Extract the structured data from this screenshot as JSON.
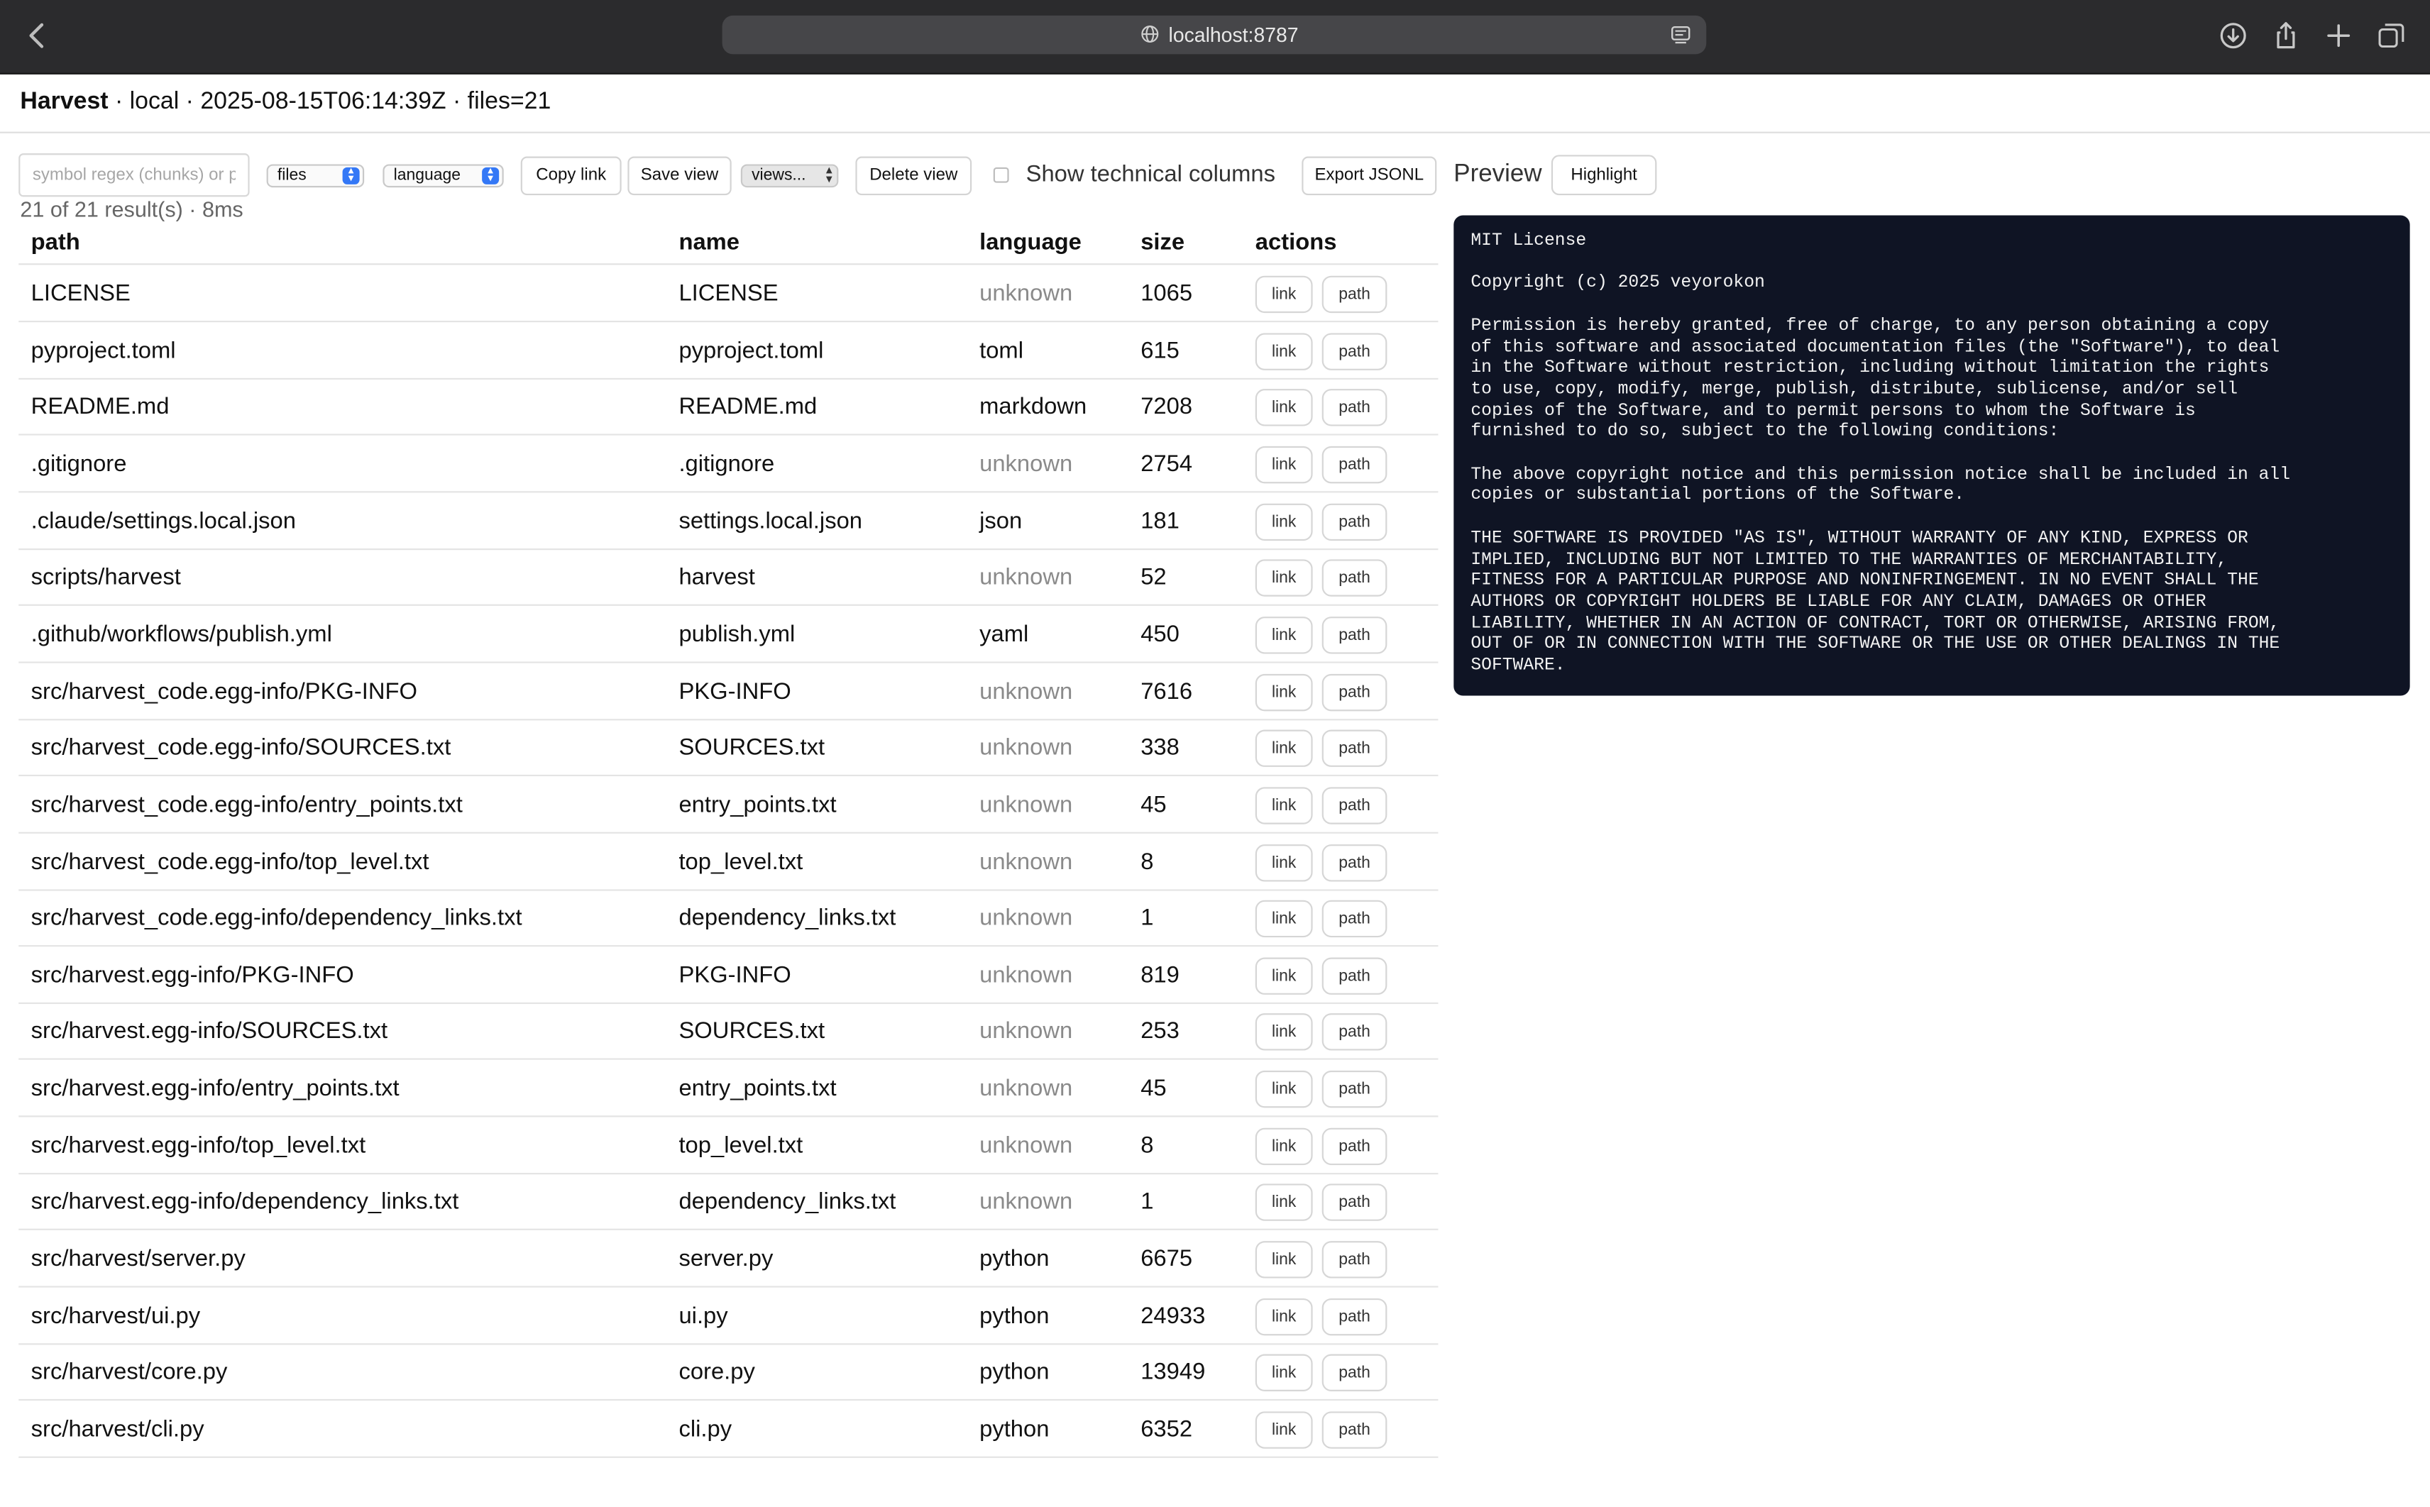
{
  "browser": {
    "url": "localhost:8787"
  },
  "header": {
    "app_name": "Harvest",
    "meta": " · local · 2025-08-15T06:14:39Z · files=21"
  },
  "toolbar": {
    "search_placeholder": "symbol regex (chunks) or p",
    "search_value": "",
    "mode_select": "files",
    "language_select": "language",
    "copy_link": "Copy link",
    "save_view": "Save view",
    "views_select": "views...",
    "delete_view": "Delete view",
    "technical_columns_label": "Show technical columns",
    "technical_columns_checked": false,
    "export_jsonl": "Export JSONL",
    "preview_label": "Preview",
    "highlight": "Highlight"
  },
  "results_summary": "21 of 21 result(s) · 8ms",
  "table": {
    "columns": [
      "path",
      "name",
      "language",
      "size",
      "actions"
    ],
    "action_labels": {
      "link": "link",
      "path": "path"
    },
    "rows": [
      {
        "path": "LICENSE",
        "name": "LICENSE",
        "language": "unknown",
        "size": "1065"
      },
      {
        "path": "pyproject.toml",
        "name": "pyproject.toml",
        "language": "toml",
        "size": "615"
      },
      {
        "path": "README.md",
        "name": "README.md",
        "language": "markdown",
        "size": "7208"
      },
      {
        "path": ".gitignore",
        "name": ".gitignore",
        "language": "unknown",
        "size": "2754"
      },
      {
        "path": ".claude/settings.local.json",
        "name": "settings.local.json",
        "language": "json",
        "size": "181"
      },
      {
        "path": "scripts/harvest",
        "name": "harvest",
        "language": "unknown",
        "size": "52"
      },
      {
        "path": ".github/workflows/publish.yml",
        "name": "publish.yml",
        "language": "yaml",
        "size": "450"
      },
      {
        "path": "src/harvest_code.egg-info/PKG-INFO",
        "name": "PKG-INFO",
        "language": "unknown",
        "size": "7616"
      },
      {
        "path": "src/harvest_code.egg-info/SOURCES.txt",
        "name": "SOURCES.txt",
        "language": "unknown",
        "size": "338"
      },
      {
        "path": "src/harvest_code.egg-info/entry_points.txt",
        "name": "entry_points.txt",
        "language": "unknown",
        "size": "45"
      },
      {
        "path": "src/harvest_code.egg-info/top_level.txt",
        "name": "top_level.txt",
        "language": "unknown",
        "size": "8"
      },
      {
        "path": "src/harvest_code.egg-info/dependency_links.txt",
        "name": "dependency_links.txt",
        "language": "unknown",
        "size": "1"
      },
      {
        "path": "src/harvest.egg-info/PKG-INFO",
        "name": "PKG-INFO",
        "language": "unknown",
        "size": "819"
      },
      {
        "path": "src/harvest.egg-info/SOURCES.txt",
        "name": "SOURCES.txt",
        "language": "unknown",
        "size": "253"
      },
      {
        "path": "src/harvest.egg-info/entry_points.txt",
        "name": "entry_points.txt",
        "language": "unknown",
        "size": "45"
      },
      {
        "path": "src/harvest.egg-info/top_level.txt",
        "name": "top_level.txt",
        "language": "unknown",
        "size": "8"
      },
      {
        "path": "src/harvest.egg-info/dependency_links.txt",
        "name": "dependency_links.txt",
        "language": "unknown",
        "size": "1"
      },
      {
        "path": "src/harvest/server.py",
        "name": "server.py",
        "language": "python",
        "size": "6675"
      },
      {
        "path": "src/harvest/ui.py",
        "name": "ui.py",
        "language": "python",
        "size": "24933"
      },
      {
        "path": "src/harvest/core.py",
        "name": "core.py",
        "language": "python",
        "size": "13949"
      },
      {
        "path": "src/harvest/cli.py",
        "name": "cli.py",
        "language": "python",
        "size": "6352"
      }
    ]
  },
  "preview": {
    "text": "MIT License\n\nCopyright (c) 2025 veyorokon\n\nPermission is hereby granted, free of charge, to any person obtaining a copy\nof this software and associated documentation files (the \"Software\"), to deal\nin the Software without restriction, including without limitation the rights\nto use, copy, modify, merge, publish, distribute, sublicense, and/or sell\ncopies of the Software, and to permit persons to whom the Software is\nfurnished to do so, subject to the following conditions:\n\nThe above copyright notice and this permission notice shall be included in all\ncopies or substantial portions of the Software.\n\nTHE SOFTWARE IS PROVIDED \"AS IS\", WITHOUT WARRANTY OF ANY KIND, EXPRESS OR\nIMPLIED, INCLUDING BUT NOT LIMITED TO THE WARRANTIES OF MERCHANTABILITY,\nFITNESS FOR A PARTICULAR PURPOSE AND NONINFRINGEMENT. IN NO EVENT SHALL THE\nAUTHORS OR COPYRIGHT HOLDERS BE LIABLE FOR ANY CLAIM, DAMAGES OR OTHER\nLIABILITY, WHETHER IN AN ACTION OF CONTRACT, TORT OR OTHERWISE, ARISING FROM,\nOUT OF OR IN CONNECTION WITH THE SOFTWARE OR THE USE OR OTHER DEALINGS IN THE\nSOFTWARE."
  },
  "colors": {
    "chrome_bg": "#2b2b2d",
    "preview_bg": "#0f1424",
    "select_accent": "#3478f6",
    "unknown_language": "#8a8a8a"
  },
  "icons": [
    "back-chevron-icon",
    "globe-icon",
    "reader-icon",
    "download-icon",
    "share-icon",
    "new-tab-plus-icon",
    "tabs-overview-icon"
  ]
}
